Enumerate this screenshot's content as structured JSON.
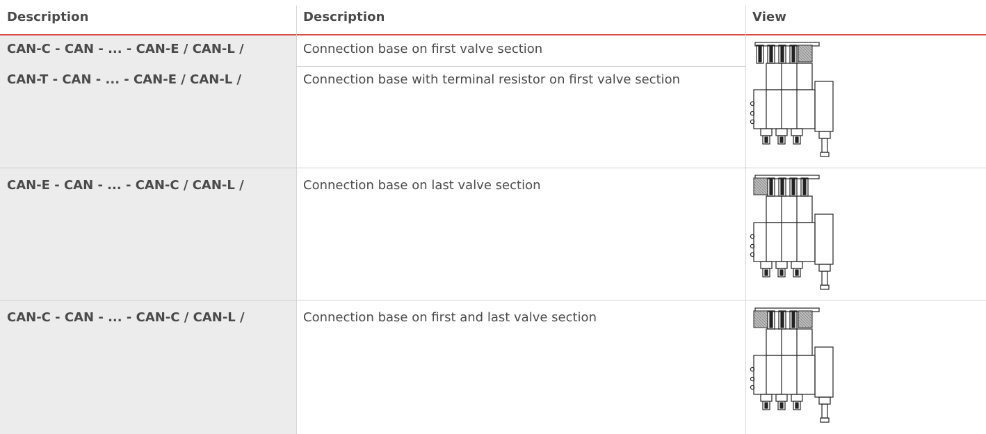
{
  "headers": [
    "Description",
    "Description",
    "View"
  ],
  "rows": [
    {
      "code": "CAN-C - CAN - ... - CAN-E / CAN-L /",
      "description": "Connection base on first valve section"
    },
    {
      "code": "CAN-T - CAN - ... - CAN-E / CAN-L /",
      "description": "Connection base with terminal resistor on first valve section"
    },
    {
      "code": "CAN-E - CAN - ... - CAN-C / CAN-L /",
      "description": "Connection base on last valve section"
    },
    {
      "code": "CAN-C - CAN - ... - CAN-C / CAN-L /",
      "description": "Connection base on first and last valve section"
    }
  ],
  "views": [
    {
      "label": "valve-block-first-connection",
      "hatched": "right"
    },
    {
      "label": "valve-block-last-connection",
      "hatched": "left"
    },
    {
      "label": "valve-block-first-last-connection",
      "hatched": "both"
    }
  ]
}
